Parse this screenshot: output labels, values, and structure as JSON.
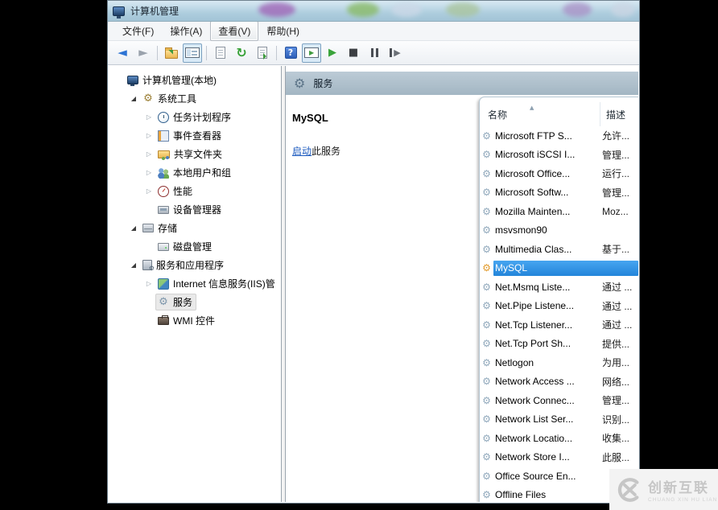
{
  "window": {
    "title": "计算机管理"
  },
  "menu": {
    "items": [
      {
        "id": "menu-item-file",
        "label": "文件(F)",
        "active": false
      },
      {
        "id": "menu-item-action",
        "label": "操作(A)",
        "active": false
      },
      {
        "id": "menu-item-view",
        "label": "查看(V)",
        "active": true
      },
      {
        "id": "menu-item-help",
        "label": "帮助(H)",
        "active": false
      }
    ]
  },
  "toolbar": {
    "buttons": [
      {
        "type": "button",
        "icon": "back-icon",
        "pressed": false
      },
      {
        "type": "button",
        "icon": "forward-icon",
        "pressed": false
      },
      {
        "type": "separator"
      },
      {
        "type": "button",
        "icon": "folder-icon",
        "pressed": false
      },
      {
        "type": "button",
        "icon": "console-tree-icon",
        "pressed": true
      },
      {
        "type": "separator"
      },
      {
        "type": "button",
        "icon": "document-icon",
        "pressed": false
      },
      {
        "type": "button",
        "icon": "refresh-icon",
        "pressed": false
      },
      {
        "type": "button",
        "icon": "export-list-icon",
        "pressed": false
      },
      {
        "type": "separator"
      },
      {
        "type": "button",
        "icon": "help-icon",
        "pressed": false
      },
      {
        "type": "button",
        "icon": "extended-view-icon",
        "pressed": true
      },
      {
        "type": "button",
        "icon": "start-service-icon",
        "pressed": false
      },
      {
        "type": "button",
        "icon": "stop-service-icon",
        "pressed": false
      },
      {
        "type": "button",
        "icon": "pause-service-icon",
        "pressed": false
      },
      {
        "type": "button",
        "icon": "restart-service-icon",
        "pressed": false
      }
    ],
    "help_glyph": "?"
  },
  "tree": {
    "items": [
      {
        "id": "tree-item-computer-management",
        "label": "计算机管理(本地)",
        "level": 0,
        "expander": "none",
        "icon": "computer-icon",
        "selected": false
      },
      {
        "id": "tree-item-system-tools",
        "label": "系统工具",
        "level": 1,
        "expander": "expanded",
        "icon": "system-tools-icon",
        "selected": false
      },
      {
        "id": "tree-item-task-scheduler",
        "label": "任务计划程序",
        "level": 2,
        "expander": "collapsed",
        "icon": "task-scheduler-icon",
        "selected": false
      },
      {
        "id": "tree-item-event-viewer",
        "label": "事件查看器",
        "level": 2,
        "expander": "collapsed",
        "icon": "event-viewer-icon",
        "selected": false
      },
      {
        "id": "tree-item-shared-folders",
        "label": "共享文件夹",
        "level": 2,
        "expander": "collapsed",
        "icon": "shared-folders-icon",
        "selected": false
      },
      {
        "id": "tree-item-local-users-groups",
        "label": "本地用户和组",
        "level": 2,
        "expander": "collapsed",
        "icon": "local-users-icon",
        "selected": false
      },
      {
        "id": "tree-item-performance",
        "label": "性能",
        "level": 2,
        "expander": "collapsed",
        "icon": "performance-icon",
        "selected": false
      },
      {
        "id": "tree-item-device-manager",
        "label": "设备管理器",
        "level": 2,
        "expander": "none",
        "icon": "device-manager-icon",
        "selected": false
      },
      {
        "id": "tree-item-storage",
        "label": "存储",
        "level": 1,
        "expander": "expanded",
        "icon": "storage-icon",
        "selected": false
      },
      {
        "id": "tree-item-disk-management",
        "label": "磁盘管理",
        "level": 2,
        "expander": "none",
        "icon": "disk-management-icon",
        "selected": false
      },
      {
        "id": "tree-item-services-apps",
        "label": "服务和应用程序",
        "level": 1,
        "expander": "expanded",
        "icon": "services-apps-icon",
        "selected": false
      },
      {
        "id": "tree-item-iis",
        "label": "Internet 信息服务(IIS)管",
        "level": 2,
        "expander": "collapsed",
        "icon": "iis-icon",
        "selected": false
      },
      {
        "id": "tree-item-services",
        "label": "服务",
        "level": 2,
        "expander": "none",
        "icon": "services-icon",
        "selected": true
      },
      {
        "id": "tree-item-wmi-control",
        "label": "WMI 控件",
        "level": 2,
        "expander": "none",
        "icon": "wmi-icon",
        "selected": false
      }
    ]
  },
  "services_pane": {
    "header": "服务",
    "service_name": "MySQL",
    "action_link": "启动",
    "action_rest": "此服务"
  },
  "list": {
    "columns": [
      {
        "id": "column-name",
        "label": "名称",
        "sort": "asc"
      },
      {
        "id": "column-description",
        "label": "描述"
      }
    ],
    "rows": [
      {
        "name": "Microsoft FTP S...",
        "desc": "允许...",
        "selected": false
      },
      {
        "name": "Microsoft iSCSI I...",
        "desc": "管理...",
        "selected": false
      },
      {
        "name": "Microsoft Office...",
        "desc": "运行...",
        "selected": false
      },
      {
        "name": "Microsoft Softw...",
        "desc": "管理...",
        "selected": false
      },
      {
        "name": "Mozilla Mainten...",
        "desc": "Moz...",
        "selected": false
      },
      {
        "name": "msvsmon90",
        "desc": "",
        "selected": false
      },
      {
        "name": "Multimedia Clas...",
        "desc": "基于...",
        "selected": false
      },
      {
        "name": "MySQL",
        "desc": "",
        "selected": true
      },
      {
        "name": "Net.Msmq Liste...",
        "desc": "通过 ...",
        "selected": false
      },
      {
        "name": "Net.Pipe Listene...",
        "desc": "通过 ...",
        "selected": false
      },
      {
        "name": "Net.Tcp Listener...",
        "desc": "通过 ...",
        "selected": false
      },
      {
        "name": "Net.Tcp Port Sh...",
        "desc": "提供...",
        "selected": false
      },
      {
        "name": "Netlogon",
        "desc": "为用...",
        "selected": false
      },
      {
        "name": "Network Access ...",
        "desc": "网络...",
        "selected": false
      },
      {
        "name": "Network Connec...",
        "desc": "管理...",
        "selected": false
      },
      {
        "name": "Network List Ser...",
        "desc": "识别...",
        "selected": false
      },
      {
        "name": "Network Locatio...",
        "desc": "收集...",
        "selected": false
      },
      {
        "name": "Network Store I...",
        "desc": "此服...",
        "selected": false
      },
      {
        "name": "Office Source En...",
        "desc": "",
        "selected": false
      },
      {
        "name": "Offline Files",
        "desc": "",
        "selected": false
      }
    ]
  },
  "watermark": {
    "title": "创新互联",
    "subtitle": "CHUANG XIN HU LIAN"
  },
  "colors": {
    "selection_blue": "#2f8be0",
    "link_blue": "#1d5bbf",
    "titlebar_blue": "#aecede",
    "services_header_bar": "#aebfcb",
    "selected_gear_orange": "#e29b2d",
    "watermark_gray": "#c6c6c6"
  }
}
